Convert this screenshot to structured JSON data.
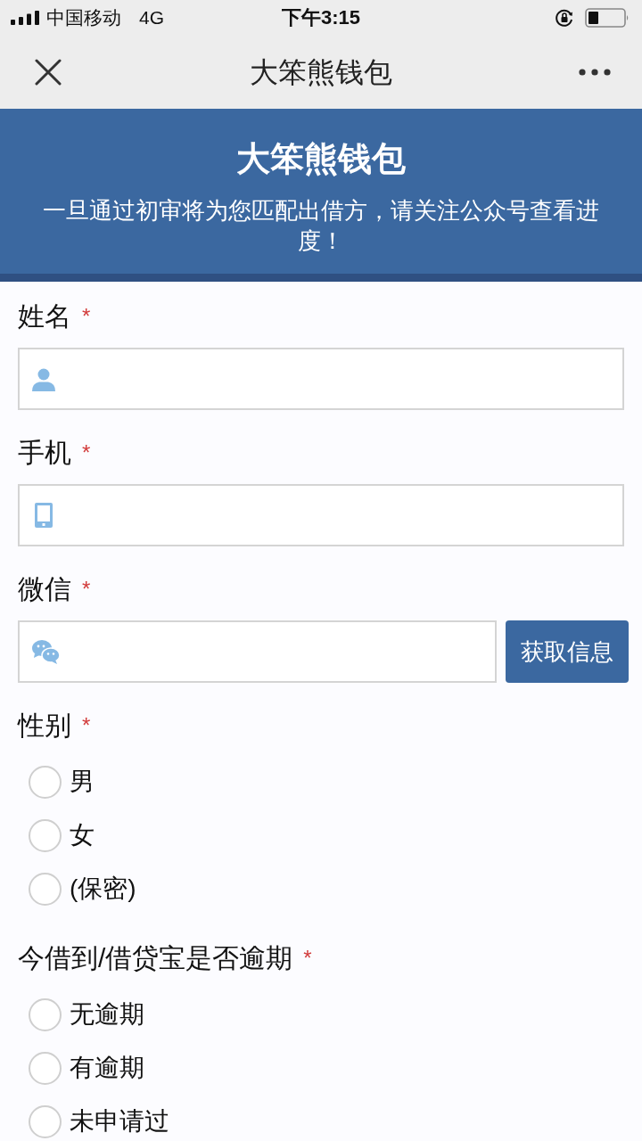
{
  "status_bar": {
    "carrier": "中国移动",
    "network": "4G",
    "time": "下午3:15"
  },
  "nav_bar": {
    "title": "大笨熊钱包"
  },
  "header": {
    "title": "大笨熊钱包",
    "subtitle": "一旦通过初审将为您匹配出借方，请关注公众号查看进度！"
  },
  "fields": [
    {
      "kind": "input",
      "label": "姓名",
      "required_mark": "*"
    },
    {
      "kind": "input",
      "label": "手机",
      "required_mark": "*"
    },
    {
      "kind": "input_button",
      "label": "微信",
      "required_mark": "*",
      "button": "获取信息"
    },
    {
      "kind": "radio",
      "label": "性别",
      "required_mark": "*",
      "options": [
        {
          "label": "男",
          "selected": false
        },
        {
          "label": "女",
          "selected": false
        },
        {
          "label": "(保密)",
          "selected": false
        }
      ]
    },
    {
      "kind": "radio",
      "label": "今借到/借贷宝是否逾期",
      "required_mark": "*",
      "options": [
        {
          "label": "无逾期",
          "selected": false
        },
        {
          "label": "有逾期",
          "selected": false
        },
        {
          "label": "未申请过",
          "selected": false
        }
      ]
    }
  ]
}
